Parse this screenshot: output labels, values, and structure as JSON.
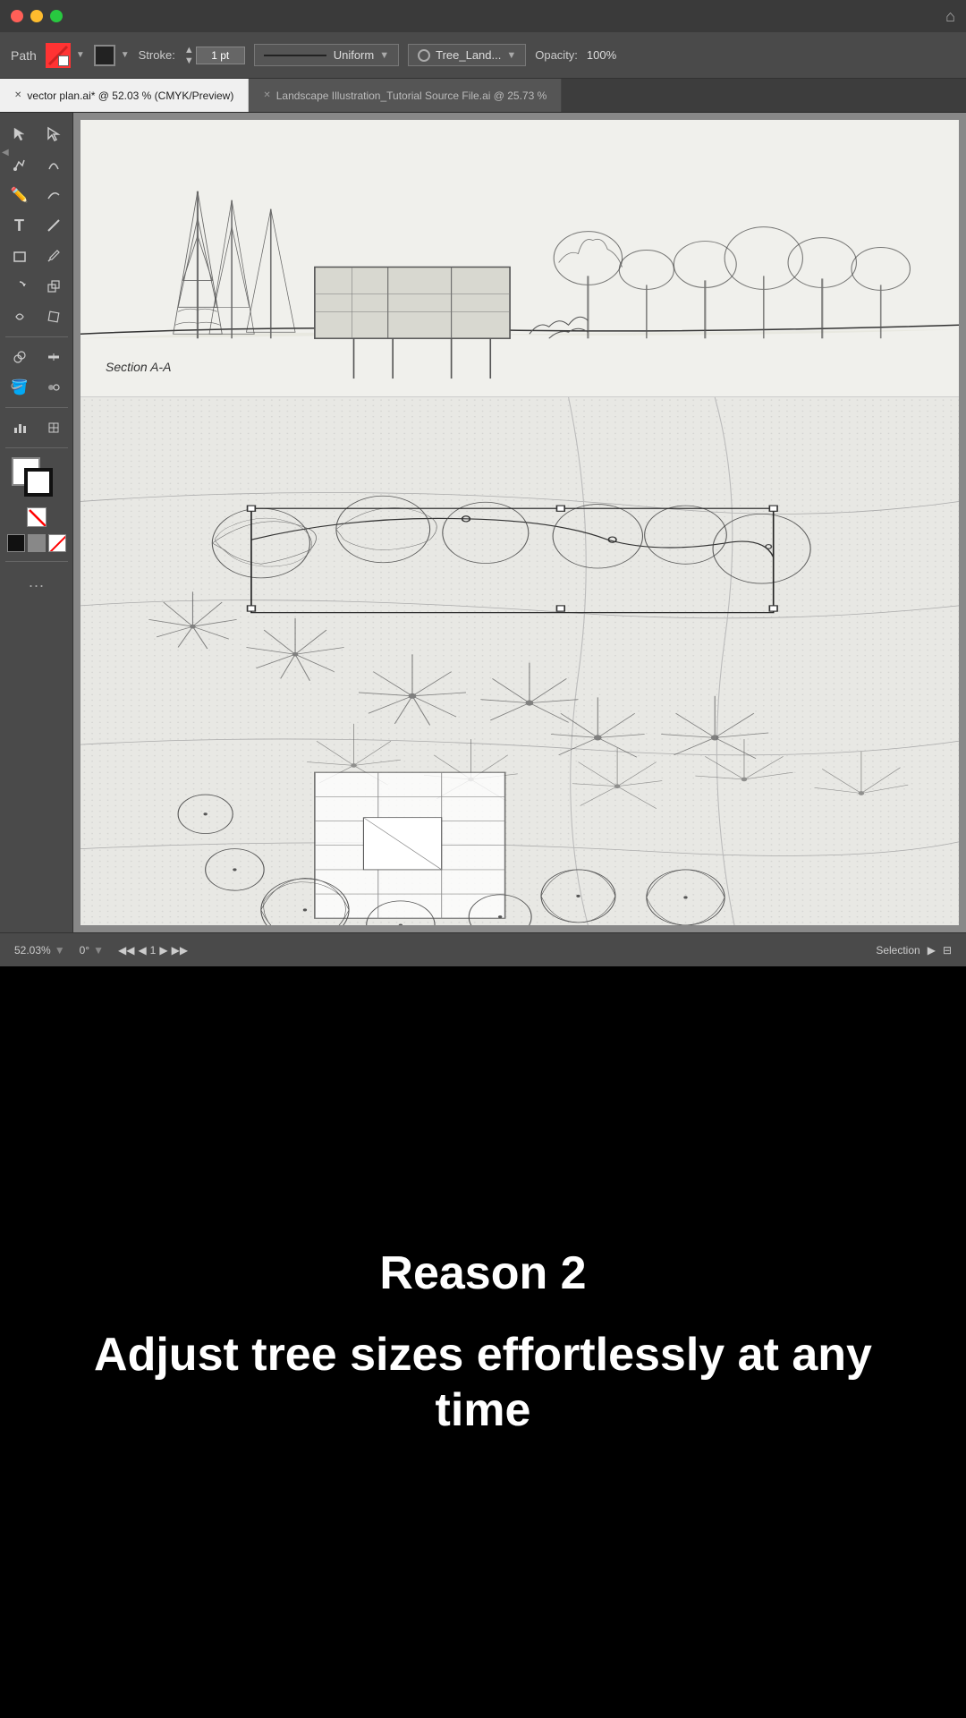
{
  "titlebar": {
    "traffic_lights": [
      "red",
      "yellow",
      "green"
    ]
  },
  "toolbar": {
    "tool_label": "Path",
    "stroke_label": "Stroke:",
    "stroke_value": "1 pt",
    "uniform_label": "Uniform",
    "tree_label": "Tree_Land...",
    "opacity_label": "Opacity:",
    "opacity_value": "100%"
  },
  "tabs": [
    {
      "label": "vector plan.ai* @ 52.03 % (CMYK/Preview)",
      "active": true
    },
    {
      "label": "Landscape Illustration_Tutorial Source File.ai @ 25.73 %",
      "active": false
    }
  ],
  "status_bar": {
    "zoom": "52.03%",
    "angle": "0°",
    "page": "1",
    "selection": "Selection"
  },
  "bottom": {
    "reason_number": "Reason 2",
    "reason_text": "Adjust tree sizes effortlessly at any time"
  },
  "section_label": "Section A-A"
}
